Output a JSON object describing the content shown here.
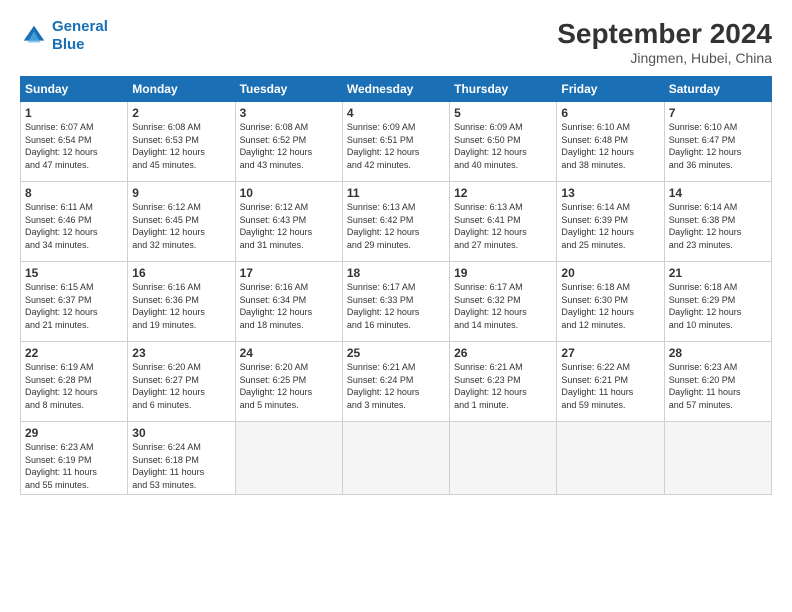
{
  "header": {
    "logo_line1": "General",
    "logo_line2": "Blue",
    "month_title": "September 2024",
    "location": "Jingmen, Hubei, China"
  },
  "days_of_week": [
    "Sunday",
    "Monday",
    "Tuesday",
    "Wednesday",
    "Thursday",
    "Friday",
    "Saturday"
  ],
  "weeks": [
    [
      {
        "day": "1",
        "info": "Sunrise: 6:07 AM\nSunset: 6:54 PM\nDaylight: 12 hours\nand 47 minutes."
      },
      {
        "day": "2",
        "info": "Sunrise: 6:08 AM\nSunset: 6:53 PM\nDaylight: 12 hours\nand 45 minutes."
      },
      {
        "day": "3",
        "info": "Sunrise: 6:08 AM\nSunset: 6:52 PM\nDaylight: 12 hours\nand 43 minutes."
      },
      {
        "day": "4",
        "info": "Sunrise: 6:09 AM\nSunset: 6:51 PM\nDaylight: 12 hours\nand 42 minutes."
      },
      {
        "day": "5",
        "info": "Sunrise: 6:09 AM\nSunset: 6:50 PM\nDaylight: 12 hours\nand 40 minutes."
      },
      {
        "day": "6",
        "info": "Sunrise: 6:10 AM\nSunset: 6:48 PM\nDaylight: 12 hours\nand 38 minutes."
      },
      {
        "day": "7",
        "info": "Sunrise: 6:10 AM\nSunset: 6:47 PM\nDaylight: 12 hours\nand 36 minutes."
      }
    ],
    [
      {
        "day": "8",
        "info": "Sunrise: 6:11 AM\nSunset: 6:46 PM\nDaylight: 12 hours\nand 34 minutes."
      },
      {
        "day": "9",
        "info": "Sunrise: 6:12 AM\nSunset: 6:45 PM\nDaylight: 12 hours\nand 32 minutes."
      },
      {
        "day": "10",
        "info": "Sunrise: 6:12 AM\nSunset: 6:43 PM\nDaylight: 12 hours\nand 31 minutes."
      },
      {
        "day": "11",
        "info": "Sunrise: 6:13 AM\nSunset: 6:42 PM\nDaylight: 12 hours\nand 29 minutes."
      },
      {
        "day": "12",
        "info": "Sunrise: 6:13 AM\nSunset: 6:41 PM\nDaylight: 12 hours\nand 27 minutes."
      },
      {
        "day": "13",
        "info": "Sunrise: 6:14 AM\nSunset: 6:39 PM\nDaylight: 12 hours\nand 25 minutes."
      },
      {
        "day": "14",
        "info": "Sunrise: 6:14 AM\nSunset: 6:38 PM\nDaylight: 12 hours\nand 23 minutes."
      }
    ],
    [
      {
        "day": "15",
        "info": "Sunrise: 6:15 AM\nSunset: 6:37 PM\nDaylight: 12 hours\nand 21 minutes."
      },
      {
        "day": "16",
        "info": "Sunrise: 6:16 AM\nSunset: 6:36 PM\nDaylight: 12 hours\nand 19 minutes."
      },
      {
        "day": "17",
        "info": "Sunrise: 6:16 AM\nSunset: 6:34 PM\nDaylight: 12 hours\nand 18 minutes."
      },
      {
        "day": "18",
        "info": "Sunrise: 6:17 AM\nSunset: 6:33 PM\nDaylight: 12 hours\nand 16 minutes."
      },
      {
        "day": "19",
        "info": "Sunrise: 6:17 AM\nSunset: 6:32 PM\nDaylight: 12 hours\nand 14 minutes."
      },
      {
        "day": "20",
        "info": "Sunrise: 6:18 AM\nSunset: 6:30 PM\nDaylight: 12 hours\nand 12 minutes."
      },
      {
        "day": "21",
        "info": "Sunrise: 6:18 AM\nSunset: 6:29 PM\nDaylight: 12 hours\nand 10 minutes."
      }
    ],
    [
      {
        "day": "22",
        "info": "Sunrise: 6:19 AM\nSunset: 6:28 PM\nDaylight: 12 hours\nand 8 minutes."
      },
      {
        "day": "23",
        "info": "Sunrise: 6:20 AM\nSunset: 6:27 PM\nDaylight: 12 hours\nand 6 minutes."
      },
      {
        "day": "24",
        "info": "Sunrise: 6:20 AM\nSunset: 6:25 PM\nDaylight: 12 hours\nand 5 minutes."
      },
      {
        "day": "25",
        "info": "Sunrise: 6:21 AM\nSunset: 6:24 PM\nDaylight: 12 hours\nand 3 minutes."
      },
      {
        "day": "26",
        "info": "Sunrise: 6:21 AM\nSunset: 6:23 PM\nDaylight: 12 hours\nand 1 minute."
      },
      {
        "day": "27",
        "info": "Sunrise: 6:22 AM\nSunset: 6:21 PM\nDaylight: 11 hours\nand 59 minutes."
      },
      {
        "day": "28",
        "info": "Sunrise: 6:23 AM\nSunset: 6:20 PM\nDaylight: 11 hours\nand 57 minutes."
      }
    ],
    [
      {
        "day": "29",
        "info": "Sunrise: 6:23 AM\nSunset: 6:19 PM\nDaylight: 11 hours\nand 55 minutes."
      },
      {
        "day": "30",
        "info": "Sunrise: 6:24 AM\nSunset: 6:18 PM\nDaylight: 11 hours\nand 53 minutes."
      },
      {
        "day": "",
        "info": ""
      },
      {
        "day": "",
        "info": ""
      },
      {
        "day": "",
        "info": ""
      },
      {
        "day": "",
        "info": ""
      },
      {
        "day": "",
        "info": ""
      }
    ]
  ]
}
